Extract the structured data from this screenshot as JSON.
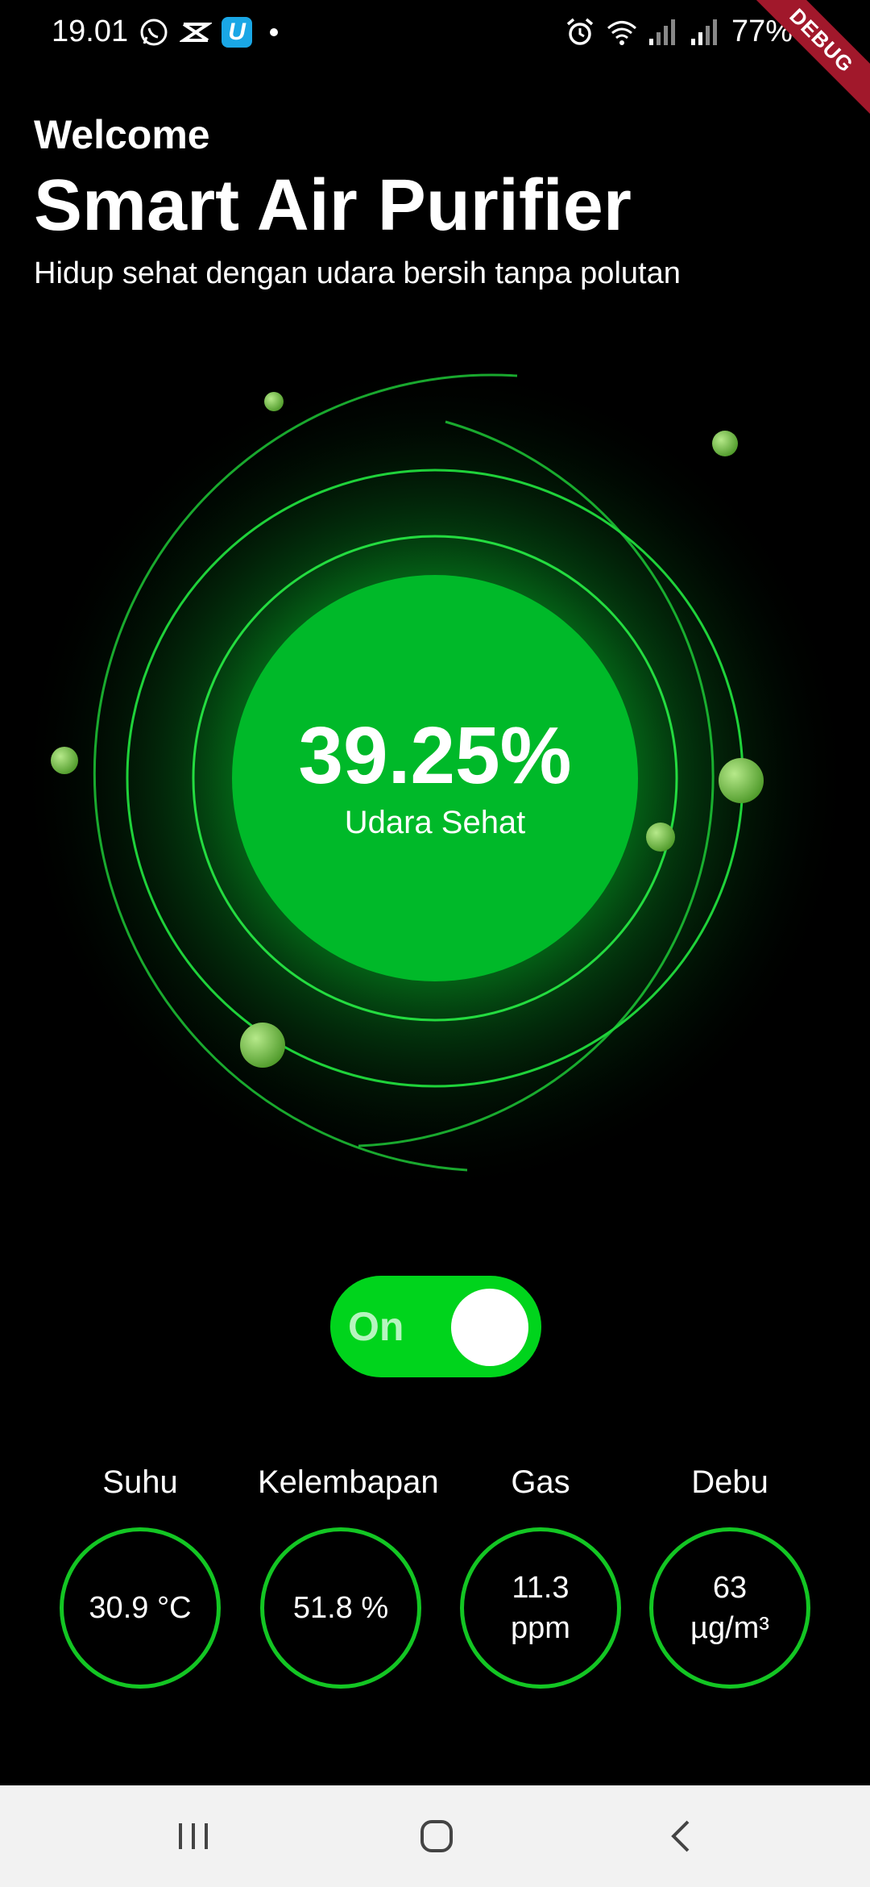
{
  "status_bar": {
    "time": "19.01",
    "battery": "77%",
    "left_icons": [
      "whatsapp-icon",
      "capcut-icon",
      "app-u-icon",
      "notification-dot-icon"
    ],
    "right_icons": [
      "alarm-icon",
      "wifi-icon",
      "signal-icon",
      "signal-icon",
      "battery-icon"
    ]
  },
  "debug_banner": "DEBUG",
  "header": {
    "welcome": "Welcome",
    "title": "Smart Air Purifier",
    "subtitle": "Hidup sehat dengan udara bersih tanpa polutan"
  },
  "purifier": {
    "percentage": "39.25%",
    "status_label": "Udara Sehat",
    "colors": {
      "core": "#00b929",
      "ring": "#1fd23a",
      "particle": "#8fd35a"
    }
  },
  "power_toggle": {
    "label": "On",
    "state": "on",
    "color": "#00d41c"
  },
  "sensors": [
    {
      "label": "Suhu",
      "value": "30.9 °C"
    },
    {
      "label": "Kelembapan",
      "value": "51.8 %"
    },
    {
      "label": "Gas",
      "value": "11.3 ppm"
    },
    {
      "label": "Debu",
      "value": "63 µg/m³"
    }
  ],
  "nav_bar": {
    "buttons": [
      "recent-apps-icon",
      "home-icon",
      "back-icon"
    ]
  }
}
